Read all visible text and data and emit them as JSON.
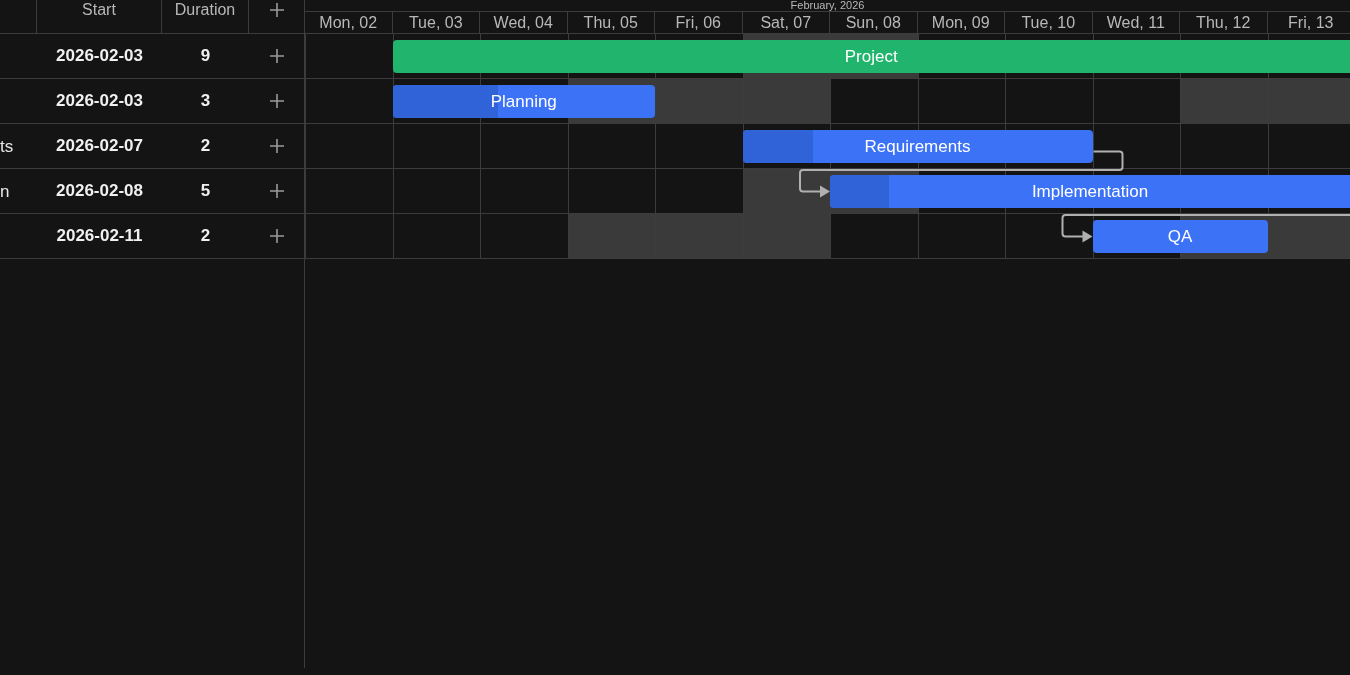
{
  "grid": {
    "columns": [
      "Start",
      "Duration"
    ]
  },
  "timeline": {
    "month": "February, 2026",
    "days": [
      "Mon, 02",
      "Tue, 03",
      "Wed, 04",
      "Thu, 05",
      "Fri, 06",
      "Sat, 07",
      "Sun, 08",
      "Mon, 09",
      "Tue, 10",
      "Wed, 11",
      "Thu, 12",
      "Fri, 13"
    ]
  },
  "tasks": [
    {
      "start": "2026-02-03",
      "duration": "9",
      "linked_from_previous": false,
      "bar": {
        "label": "Project",
        "kind": "summary"
      },
      "cells": [
        {
          "shaded": false
        },
        {
          "shaded": false
        },
        {
          "shaded": false
        },
        {
          "shaded": false
        },
        {
          "shaded": false
        },
        {
          "shaded": true
        },
        {
          "shaded": true
        },
        {
          "shaded": false
        },
        {
          "shaded": false
        },
        {
          "shaded": false
        },
        {
          "shaded": false
        },
        {
          "shaded": false
        }
      ]
    },
    {
      "start": "2026-02-03",
      "duration": "3",
      "linked_from_previous": false,
      "bar": {
        "label": "Planning",
        "kind": "task",
        "level": 0.4
      },
      "cells": [
        {
          "shaded": false
        },
        {
          "shaded": false
        },
        {
          "shaded": false
        },
        {
          "shaded": true
        },
        {
          "shaded": true
        },
        {
          "shaded": true
        },
        {
          "shaded": false
        },
        {
          "shaded": false
        },
        {
          "shaded": false
        },
        {
          "shaded": false
        },
        {
          "shaded": true
        },
        {
          "shaded": true
        }
      ]
    },
    {
      "name": "ts",
      "start": "2026-02-07",
      "duration": "2",
      "linked_from_previous": false,
      "bar": {
        "label": "Requirements",
        "kind": "task",
        "level": 0.2
      },
      "cells": [
        {
          "shaded": false
        },
        {
          "shaded": false
        },
        {
          "shaded": false
        },
        {
          "shaded": false
        },
        {
          "shaded": false
        },
        {
          "shaded": false
        },
        {
          "shaded": false
        },
        {
          "shaded": false
        },
        {
          "shaded": false
        },
        {
          "shaded": false
        },
        {
          "shaded": false
        },
        {
          "shaded": false
        }
      ]
    },
    {
      "name": "n",
      "start": "2026-02-08",
      "duration": "5",
      "linked_from_previous": true,
      "bar": {
        "label": "Implementation",
        "kind": "task",
        "level": 0.1
      },
      "cells": [
        {
          "shaded": false
        },
        {
          "shaded": false
        },
        {
          "shaded": false
        },
        {
          "shaded": false
        },
        {
          "shaded": false
        },
        {
          "shaded": true
        },
        {
          "shaded": true
        },
        {
          "shaded": false
        },
        {
          "shaded": false
        },
        {
          "shaded": false
        },
        {
          "shaded": false
        },
        {
          "shaded": false
        }
      ]
    },
    {
      "start": "2026-02-11",
      "duration": "2",
      "linked_from_previous": true,
      "bar": {
        "label": "QA",
        "kind": "task"
      },
      "cells": [
        {
          "shaded": false
        },
        {
          "shaded": false
        },
        {
          "shaded": false
        },
        {
          "shaded": true
        },
        {
          "shaded": true
        },
        {
          "shaded": true
        },
        {
          "shaded": false
        },
        {
          "shaded": false
        },
        {
          "shaded": false
        },
        {
          "shaded": false
        },
        {
          "shaded": true
        },
        {
          "shaded": true
        }
      ]
    }
  ]
}
